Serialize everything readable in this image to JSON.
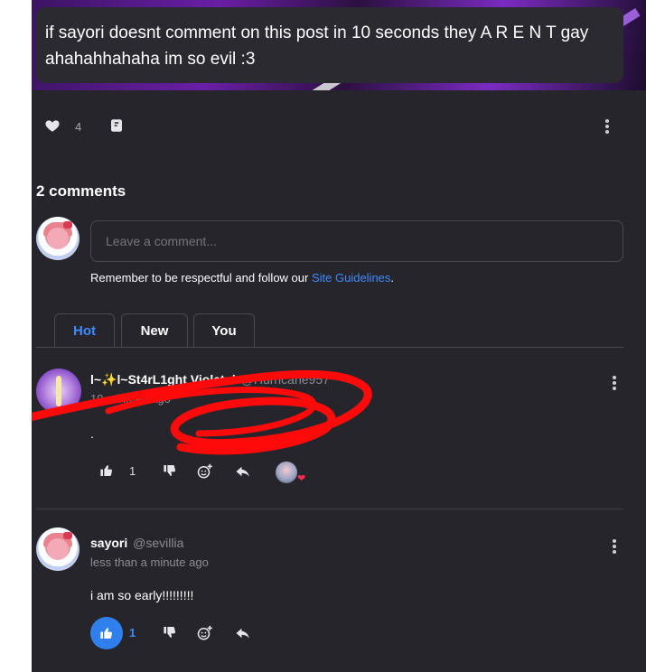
{
  "post": {
    "caption": "if sayori doesnt comment on this post in 10 seconds they A R E N T  gay ahahahhahaha im so evil :3",
    "like_count": "4"
  },
  "comments_section": {
    "title": "2 comments",
    "input_placeholder": "Leave a comment...",
    "guidelines_prefix": "Remember to be respectful and follow our ",
    "guidelines_link": "Site Guidelines",
    "guidelines_suffix": ".",
    "tabs": [
      {
        "label": "Hot",
        "active": true
      },
      {
        "label": "New",
        "active": false
      },
      {
        "label": "You",
        "active": false
      }
    ]
  },
  "comments": [
    {
      "name": "l~✨l~St4rL1ght Violet~l",
      "handle": "@Hurricane957",
      "time": "19 minutes ago",
      "text": ".",
      "like_count": "1",
      "liked": false,
      "reacted_heart": true
    },
    {
      "name": "sayori",
      "handle": "@sevillia",
      "time": "less than a minute ago",
      "text": "i am so early!!!!!!!!!",
      "like_count": "1",
      "liked": true
    }
  ],
  "colors": {
    "panel_bg": "#26252b",
    "accent_blue": "#3d8bff",
    "like_active": "#2f80ed",
    "scribble_red": "#ff0a0a",
    "heart_red": "#ff2b50"
  },
  "icons": [
    "heart-icon",
    "flag-hand-icon",
    "more-vertical-icon",
    "thumbs-up-icon",
    "thumbs-down-icon",
    "add-reaction-icon",
    "reply-arrow-icon"
  ]
}
